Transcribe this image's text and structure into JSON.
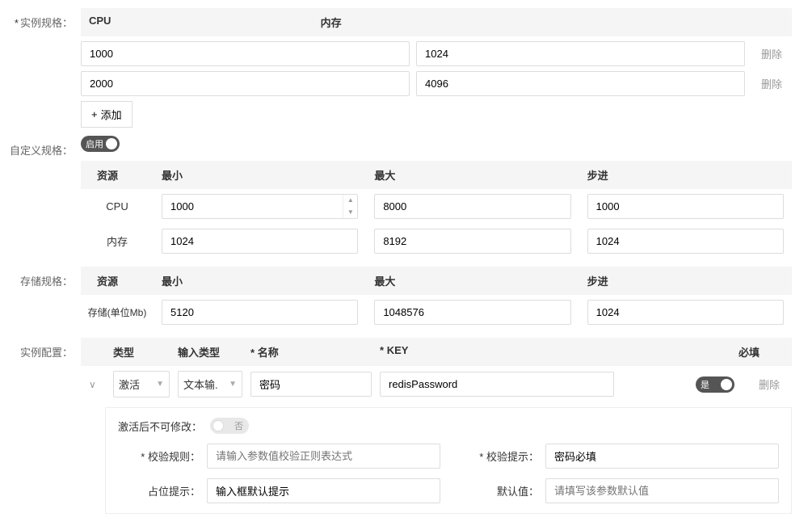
{
  "instanceSpec": {
    "label": "实例规格：",
    "required": "*",
    "headers": {
      "cpu": "CPU",
      "memory": "内存"
    },
    "rows": [
      {
        "cpu": "1000",
        "memory": "1024",
        "delete": "删除"
      },
      {
        "cpu": "2000",
        "memory": "4096",
        "delete": "删除"
      }
    ],
    "addBtn": "添加"
  },
  "customSpec": {
    "label": "自定义规格：",
    "toggleText": "启用",
    "headers": {
      "resource": "资源",
      "min": "最小",
      "max": "最大",
      "step": "步进"
    },
    "rows": [
      {
        "resource": "CPU",
        "min": "1000",
        "max": "8000",
        "step": "1000",
        "stepper": true
      },
      {
        "resource": "内存",
        "min": "1024",
        "max": "8192",
        "step": "1024",
        "stepper": false
      }
    ]
  },
  "storageSpec": {
    "label": "存储规格：",
    "headers": {
      "resource": "资源",
      "min": "最小",
      "max": "最大",
      "step": "步进"
    },
    "rows": [
      {
        "resource": "存储(单位Mb)",
        "min": "5120",
        "max": "1048576",
        "step": "1024"
      }
    ]
  },
  "instanceConfig": {
    "label": "实例配置：",
    "headers": {
      "type": "类型",
      "inputType": "输入类型",
      "name": "名称",
      "nameReq": "*",
      "key": "KEY",
      "keyReq": "*",
      "required": "必填"
    },
    "row": {
      "type": "激活",
      "inputType": "文本输.",
      "name": "密码",
      "key": "redisPassword",
      "requiredToggle": "是",
      "delete": "删除"
    },
    "sub": {
      "noModifyLabel": "激活后不可修改：",
      "noModifyToggle": "否",
      "validationRuleLabel": "校验规则：",
      "validationRuleReq": "*",
      "validationRulePlaceholder": "请输入参数值校验正则表达式",
      "validationTipLabel": "校验提示：",
      "validationTipReq": "*",
      "validationTipValue": "密码必填",
      "placeholderLabel": "占位提示：",
      "placeholderValue": "输入框默认提示",
      "defaultLabel": "默认值：",
      "defaultPlaceholder": "请填写该参数默认值"
    }
  }
}
